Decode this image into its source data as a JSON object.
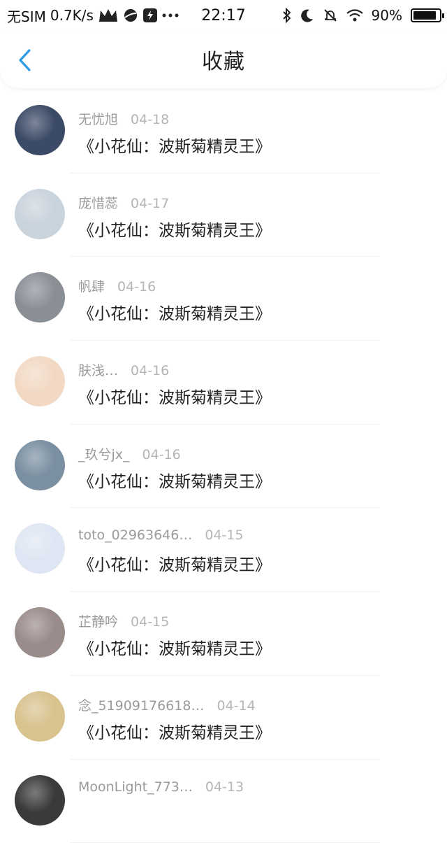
{
  "status_bar": {
    "carrier": "无SIM",
    "speed": "0.7K/s",
    "time": "22:17",
    "battery": "90%",
    "battery_level": 0.9
  },
  "header": {
    "title": "收藏",
    "back_icon": "chevron-left-icon",
    "accent": "#2e9be6"
  },
  "items": [
    {
      "user": "无忧旭",
      "date": "04-18",
      "title": "《小花仙：波斯菊精灵王》",
      "avatar_color": "#3b4a66"
    },
    {
      "user": "庞惜蕊",
      "date": "04-17",
      "title": "《小花仙：波斯菊精灵王》",
      "avatar_color": "#c9d3dc"
    },
    {
      "user": "帆肆",
      "date": "04-16",
      "title": "《小花仙：波斯菊精灵王》",
      "avatar_color": "#8a8f96"
    },
    {
      "user": "肤浅…",
      "date": "04-16",
      "title": "《小花仙：波斯菊精灵王》",
      "avatar_color": "#f2d9c4"
    },
    {
      "user": "_玖兮jx_",
      "date": "04-16",
      "title": "《小花仙：波斯菊精灵王》",
      "avatar_color": "#7a8fa1"
    },
    {
      "user": "toto_02963646…",
      "date": "04-15",
      "title": "《小花仙：波斯菊精灵王》",
      "avatar_color": "#dfe6f3"
    },
    {
      "user": "芷静吟",
      "date": "04-15",
      "title": "《小花仙：波斯菊精灵王》",
      "avatar_color": "#9a8c8a"
    },
    {
      "user": "念_51909176618…",
      "date": "04-14",
      "title": "《小花仙：波斯菊精灵王》",
      "avatar_color": "#d8c28e"
    },
    {
      "user": "MoonLight_773…",
      "date": "04-13",
      "title": "",
      "avatar_color": "#3a3a3a"
    }
  ]
}
